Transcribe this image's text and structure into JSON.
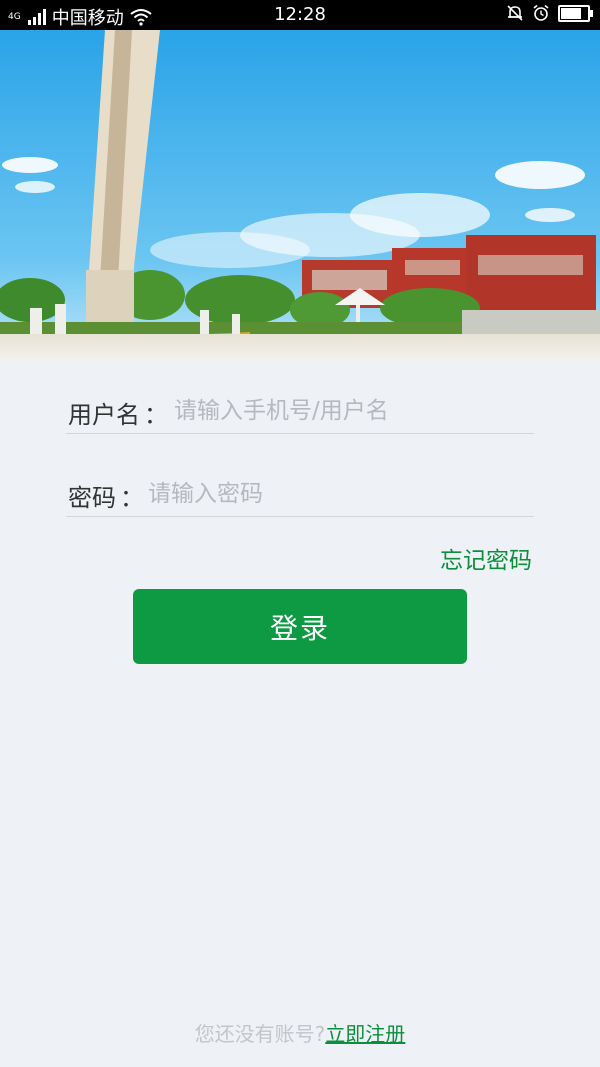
{
  "status_bar": {
    "network_type": "4G",
    "carrier": "中国移动",
    "time": "12:28",
    "battery_level": 0.85
  },
  "login_form": {
    "username_label": "用户名",
    "username_placeholder": "请输入手机号/用户名",
    "password_label": "密码",
    "password_placeholder": "请输入密码",
    "colon": "：",
    "forgot_password": "忘记密码",
    "login_button": "登录"
  },
  "footer": {
    "no_account_text": "您还没有账号?",
    "register_link": "立即注册"
  },
  "colors": {
    "accent_green": "#0e9a43",
    "background": "#eef2f6"
  }
}
